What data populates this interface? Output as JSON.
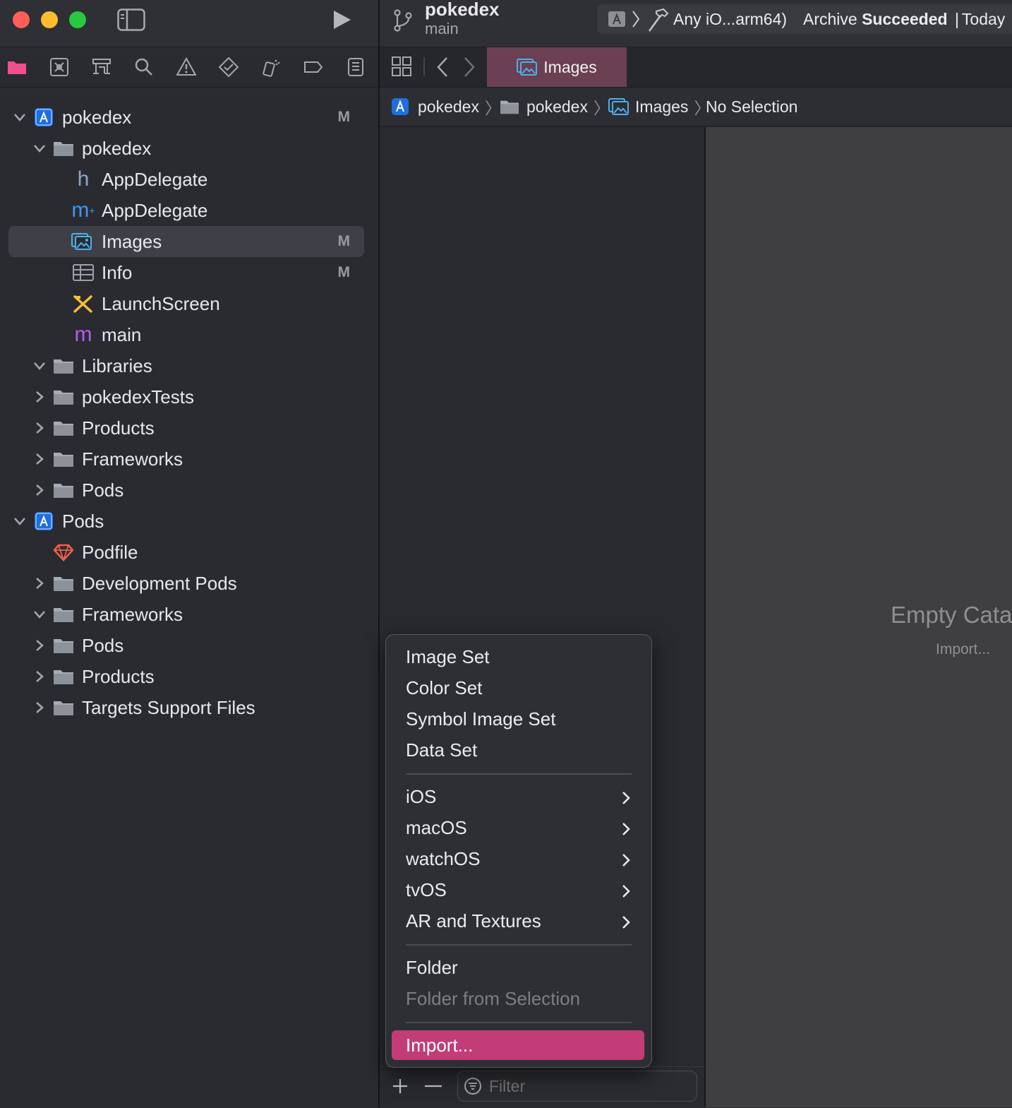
{
  "colors": {
    "close": "#ff5f57",
    "minimize": "#febc2e",
    "zoom": "#28c840",
    "accent_pink": "#c23c78",
    "selected_tab": "#6a4052",
    "folder": "#a7abb3",
    "swift_blue": "#3c97f0",
    "launch_yellow": "#f5c03a",
    "main_purple": "#b65cf0",
    "podfile_red": "#f0604a"
  },
  "toolbar": {
    "project": "pokedex",
    "branch": "main",
    "destination": "Any iO...arm64)",
    "status_prefix": "Archive ",
    "status_bold": "Succeeded",
    "status_sep": "|",
    "status_time": "Today"
  },
  "navigator_tabs": [
    "folder-icon",
    "source-control-icon",
    "symbol-icon",
    "search-icon",
    "warning-icon",
    "test-icon",
    "debug-icon",
    "breakpoint-icon",
    "report-icon"
  ],
  "tree": [
    {
      "label": "pokedex",
      "icon": "project-icon",
      "expanded": true,
      "badge": "M"
    },
    {
      "label": "pokedex",
      "icon": "folder-icon",
      "expanded": true,
      "badge": ""
    },
    {
      "label": "AppDelegate",
      "icon": "header-h-icon",
      "badge": ""
    },
    {
      "label": "AppDelegate",
      "icon": "objc-m-icon",
      "badge": ""
    },
    {
      "label": "Images",
      "icon": "asset-catalog-icon",
      "badge": "M",
      "selected": true
    },
    {
      "label": "Info",
      "icon": "plist-table-icon",
      "badge": "M"
    },
    {
      "label": "LaunchScreen",
      "icon": "storyboard-icon",
      "badge": ""
    },
    {
      "label": "main",
      "icon": "main-m-icon",
      "badge": ""
    },
    {
      "label": "Libraries",
      "icon": "folder-icon",
      "expanded": true,
      "badge": ""
    },
    {
      "label": "pokedexTests",
      "icon": "folder-icon",
      "expanded": false,
      "badge": ""
    },
    {
      "label": "Products",
      "icon": "folder-icon",
      "expanded": false,
      "badge": ""
    },
    {
      "label": "Frameworks",
      "icon": "folder-icon",
      "expanded": false,
      "badge": ""
    },
    {
      "label": "Pods",
      "icon": "folder-icon",
      "expanded": false,
      "badge": ""
    },
    {
      "label": "Pods",
      "icon": "project-icon",
      "expanded": true,
      "badge": ""
    },
    {
      "label": "Podfile",
      "icon": "ruby-gem-icon",
      "badge": ""
    },
    {
      "label": "Development Pods",
      "icon": "folder-icon",
      "expanded": false,
      "badge": ""
    },
    {
      "label": "Frameworks",
      "icon": "folder-icon",
      "expanded": true,
      "badge": ""
    },
    {
      "label": "Pods",
      "icon": "folder-icon",
      "expanded": false,
      "badge": ""
    },
    {
      "label": "Products",
      "icon": "folder-icon",
      "expanded": false,
      "badge": ""
    },
    {
      "label": "Targets Support Files",
      "icon": "folder-icon",
      "expanded": false,
      "badge": ""
    }
  ],
  "editor": {
    "tab_label": "Images",
    "breadcrumb": [
      "pokedex",
      "pokedex",
      "Images",
      "No Selection"
    ],
    "empty_title": "Empty Cata",
    "empty_import": "Import..."
  },
  "filter": {
    "placeholder": "Filter"
  },
  "menu": {
    "group1": [
      "Image Set",
      "Color Set",
      "Symbol Image Set",
      "Data Set"
    ],
    "group2": [
      "iOS",
      "macOS",
      "watchOS",
      "tvOS",
      "AR and Textures"
    ],
    "group3": [
      "Folder",
      "Folder from Selection"
    ],
    "import": "Import..."
  }
}
